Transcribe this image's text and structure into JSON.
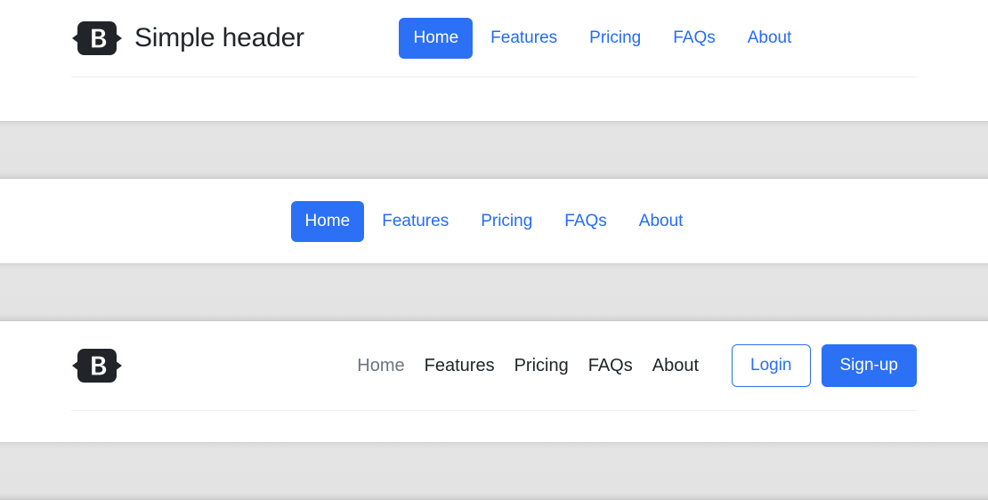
{
  "colors": {
    "primary": "#2b70f5",
    "link": "#246bfd",
    "text_dark": "#212529",
    "text_muted": "#6c757d",
    "band_gray": "#e3e3e3",
    "divider": "#eceef0",
    "logo_dark": "#212529"
  },
  "header_simple": {
    "logo_icon": "bootstrap-b-logo",
    "brand_title": "Simple header",
    "nav": [
      {
        "label": "Home",
        "active": true
      },
      {
        "label": "Features",
        "active": false
      },
      {
        "label": "Pricing",
        "active": false
      },
      {
        "label": "FAQs",
        "active": false
      },
      {
        "label": "About",
        "active": false
      }
    ]
  },
  "header_centered": {
    "nav": [
      {
        "label": "Home",
        "active": true
      },
      {
        "label": "Features",
        "active": false
      },
      {
        "label": "Pricing",
        "active": false
      },
      {
        "label": "FAQs",
        "active": false
      },
      {
        "label": "About",
        "active": false
      }
    ]
  },
  "header_actions": {
    "logo_icon": "bootstrap-b-logo",
    "nav": [
      {
        "label": "Home",
        "active": true
      },
      {
        "label": "Features",
        "active": false
      },
      {
        "label": "Pricing",
        "active": false
      },
      {
        "label": "FAQs",
        "active": false
      },
      {
        "label": "About",
        "active": false
      }
    ],
    "login_label": "Login",
    "signup_label": "Sign-up"
  }
}
